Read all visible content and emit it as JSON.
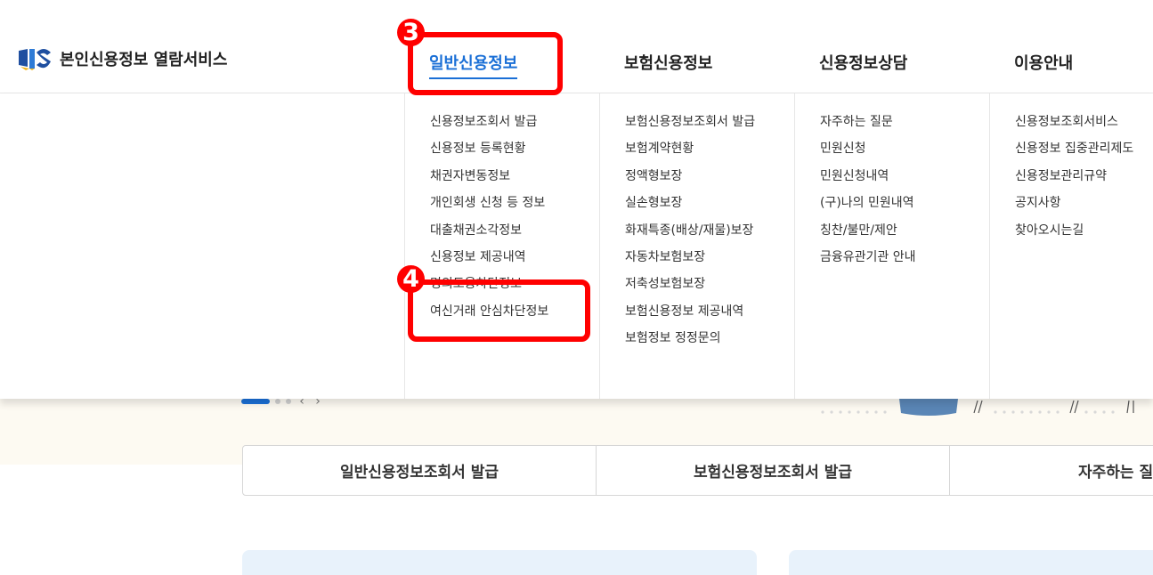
{
  "header": {
    "logo_text": "본인신용정보 열람서비스",
    "nav": [
      {
        "label": "일반신용정보",
        "active": true
      },
      {
        "label": "보험신용정보",
        "active": false
      },
      {
        "label": "신용정보상담",
        "active": false
      },
      {
        "label": "이용안내",
        "active": false
      }
    ]
  },
  "mega_menu": {
    "columns": [
      {
        "items": [
          "신용정보조회서 발급",
          "신용정보 등록현황",
          "채권자변동정보",
          "개인회생 신청 등 정보",
          "대출채권소각정보",
          "신용정보 제공내역",
          "명의도용차단정보",
          "여신거래 안심차단정보"
        ]
      },
      {
        "items": [
          "보험신용정보조회서 발급",
          "보험계약현황",
          "정액형보장",
          "실손형보장",
          "화재특종(배상/재물)보장",
          "자동차보험보장",
          "저축성보험보장",
          "보험신용정보 제공내역",
          "보험정보 정정문의"
        ]
      },
      {
        "items": [
          "자주하는 질문",
          "민원신청",
          "민원신청내역",
          "(구)나의 민원내역",
          "칭찬/불만/제안",
          "금융유관기관 안내"
        ]
      },
      {
        "items": [
          "신용정보조회서비스",
          "신용정보 집중관리제도",
          "신용정보관리규약",
          "공지사항",
          "찾아오시는길"
        ]
      }
    ]
  },
  "hero": {
    "prev_arrow": "‹",
    "next_arrow": "›"
  },
  "quick_links": [
    "일반신용정보조회서 발급",
    "보험신용정보조회서 발급",
    "자주하는 질문"
  ],
  "annotations": [
    {
      "number": "3",
      "target": "일반신용정보"
    },
    {
      "number": "4",
      "target": "여신거래 안심차단정보"
    }
  ],
  "colors": {
    "accent": "#1a6fd6",
    "annotation": "#ff0000",
    "hero_bg": "#fdfaf2",
    "card_bg": "#e8f2fb"
  }
}
